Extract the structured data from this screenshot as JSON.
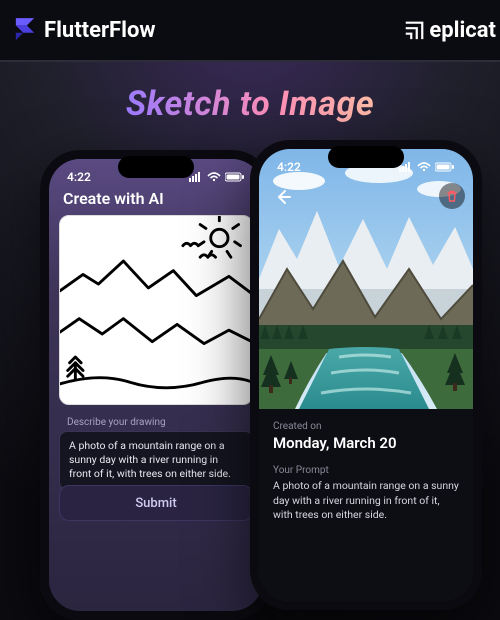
{
  "topbar": {
    "brand_left": "FlutterFlow",
    "brand_right": "eplicat"
  },
  "headline": "Sketch to Image",
  "phone_left": {
    "status_time": "4:22",
    "title": "Create with AI",
    "prompt_label": "Describe your drawing",
    "prompt_value": "A photo of a mountain range on a sunny day with a river running in front of it, with trees on either side.",
    "submit_label": "Submit"
  },
  "phone_right": {
    "status_time": "4:22",
    "created_label": "Created on",
    "created_value": "Monday, March 20",
    "your_prompt_label": "Your Prompt",
    "your_prompt_value": "A photo of a mountain range on a sunny day with a river running in front of it, with trees on either side."
  }
}
